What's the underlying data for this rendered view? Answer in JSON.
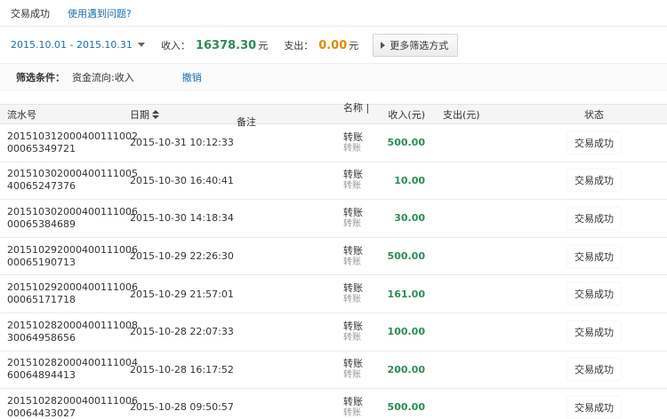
{
  "header": {
    "title": "交易成功",
    "help_link": "使用遇到问题?"
  },
  "filters": {
    "date_range": "2015.10.01 - 2015.10.31",
    "income_label": "收入：",
    "income_value": "16378.30",
    "income_unit": "元",
    "expense_label": "支出：",
    "expense_value": "0.00",
    "expense_unit": "元",
    "more_filters": "更多筛选方式"
  },
  "conditions": {
    "label": "筛选条件：",
    "value": "资金流向:收入",
    "revoke": "撤销"
  },
  "table": {
    "columns": {
      "id": "流水号",
      "date": "日期",
      "name": "名称 | 备注",
      "income": "收入(元)",
      "expense": "支出(元)",
      "status": "状态"
    },
    "rows": [
      {
        "id1": "201510312000400111002",
        "id2": "00065349721",
        "date": "2015-10-31 10:12:33",
        "name": "转账",
        "remark": "转账",
        "income": "500.00",
        "status": "交易成功"
      },
      {
        "id1": "201510302000400111005",
        "id2": "40065247376",
        "date": "2015-10-30 16:40:41",
        "name": "转账",
        "remark": "转账",
        "income": "10.00",
        "status": "交易成功"
      },
      {
        "id1": "201510302000400111006",
        "id2": "00065384689",
        "date": "2015-10-30 14:18:34",
        "name": "转账",
        "remark": "转账",
        "income": "30.00",
        "status": "交易成功"
      },
      {
        "id1": "201510292000400111006",
        "id2": "00065190713",
        "date": "2015-10-29 22:26:30",
        "name": "转账",
        "remark": "转账",
        "income": "500.00",
        "status": "交易成功"
      },
      {
        "id1": "201510292000400111006",
        "id2": "00065171718",
        "date": "2015-10-29 21:57:01",
        "name": "转账",
        "remark": "转账",
        "income": "161.00",
        "status": "交易成功"
      },
      {
        "id1": "201510282000400111008",
        "id2": "30064958656",
        "date": "2015-10-28 22:07:33",
        "name": "转账",
        "remark": "转账",
        "income": "100.00",
        "status": "交易成功"
      },
      {
        "id1": "201510282000400111004",
        "id2": "60064894413",
        "date": "2015-10-28 16:17:52",
        "name": "转账",
        "remark": "转账",
        "income": "200.00",
        "status": "交易成功"
      },
      {
        "id1": "201510282000400111006",
        "id2": "00064433027",
        "date": "2015-10-28 09:50:57",
        "name": "转账",
        "remark": "转账",
        "income": "500.00",
        "status": "交易成功"
      }
    ]
  }
}
